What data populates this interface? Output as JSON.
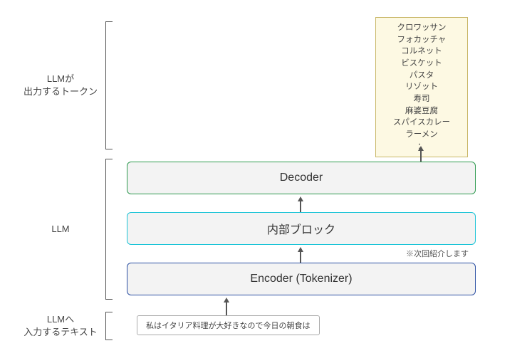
{
  "labels": {
    "output_tokens": "LLMが\n出力するトークン",
    "llm": "LLM",
    "input_text": "LLMへ\n入力するテキスト"
  },
  "blocks": {
    "decoder": "Decoder",
    "inner": "内部ブロック",
    "encoder": "Encoder (Tokenizer)"
  },
  "note_next": "※次回紹介します",
  "input_sentence": "私はイタリア料理が大好きなので今日の朝食は",
  "output_tokens": [
    "クロワッサン",
    "フォカッチャ",
    "コルネット",
    "ビスケット",
    "パスタ",
    "リゾット",
    "寿司",
    "麻婆豆腐",
    "スパイスカレー",
    "ラーメン",
    "："
  ]
}
